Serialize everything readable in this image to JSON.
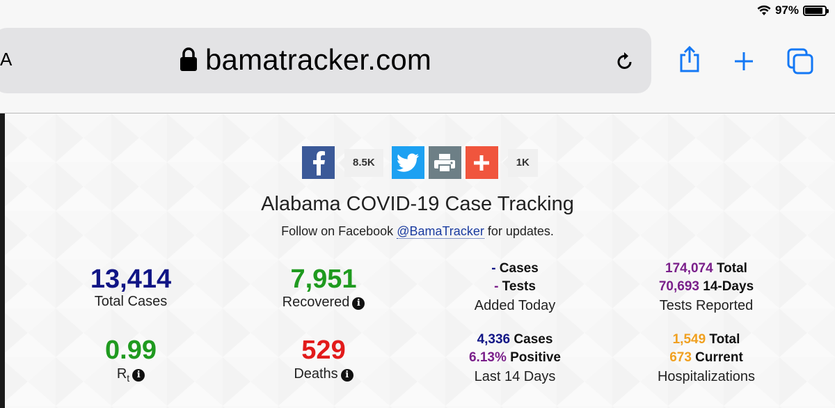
{
  "status_bar": {
    "battery_text": "97%",
    "battery_level": 0.97
  },
  "browser": {
    "url": "bamatracker.com",
    "left_fragment": "A"
  },
  "share": {
    "facebook_count": "8.5K",
    "total_count": "1K"
  },
  "header": {
    "title": "Alabama COVID-19 Case Tracking",
    "follow_prefix": "Follow on Facebook ",
    "follow_link": "@BamaTracker",
    "follow_suffix": " for updates."
  },
  "colors": {
    "navy": "#101585",
    "green": "#1f9a1f",
    "red": "#e21b1b",
    "purple": "#7a1f8a",
    "orange": "#f0a020"
  },
  "stats": {
    "total_cases": {
      "value": "13,414",
      "label": "Total Cases"
    },
    "recovered": {
      "value": "7,951",
      "label": "Recovered"
    },
    "added_today": {
      "cases_value": "-",
      "cases_label": " Cases",
      "tests_value": "-",
      "tests_label": " Tests",
      "label": "Added Today"
    },
    "tests_reported": {
      "total_value": "174,074",
      "total_label": " Total",
      "days_value": "70,693",
      "days_label": " 14-Days",
      "label": "Tests Reported"
    },
    "rt": {
      "value": "0.99",
      "label_main": "R",
      "label_sub": "t"
    },
    "deaths": {
      "value": "529",
      "label": "Deaths"
    },
    "last_14": {
      "cases_value": "4,336",
      "cases_label": " Cases",
      "pos_value": "6.13%",
      "pos_label": " Positive",
      "label": "Last 14 Days"
    },
    "hospital": {
      "total_value": "1,549",
      "total_label": " Total",
      "current_value": "673",
      "current_label": " Current",
      "label": "Hospitalizations"
    }
  }
}
